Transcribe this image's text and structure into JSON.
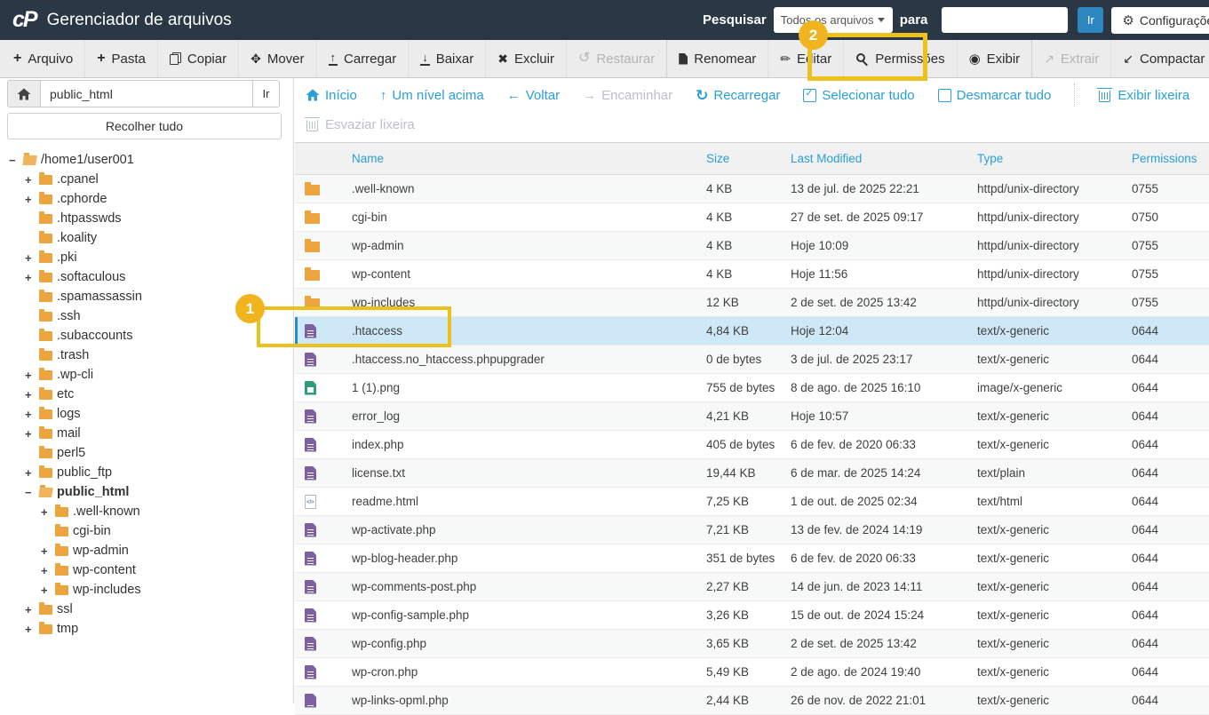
{
  "header": {
    "logo": "cP",
    "title": "Gerenciador de arquivos",
    "search_label": "Pesquisar",
    "search_scope": "Todos os arquivos",
    "para_label": "para",
    "search_value": "",
    "go_button": "Ir",
    "settings_button": "Configurações"
  },
  "toolbar": {
    "items": [
      {
        "label": "Arquivo",
        "icon": "plus-icon",
        "disabled": "false"
      },
      {
        "label": "Pasta",
        "icon": "plus-icon",
        "disabled": "false"
      },
      {
        "label": "Copiar",
        "icon": "copy-icon",
        "disabled": "false"
      },
      {
        "label": "Mover",
        "icon": "move-icon",
        "disabled": "false"
      },
      {
        "label": "Carregar",
        "icon": "upload-icon",
        "disabled": "false"
      },
      {
        "label": "Baixar",
        "icon": "download-icon",
        "disabled": "false"
      },
      {
        "label": "Excluir",
        "icon": "delete-icon",
        "disabled": "false"
      },
      {
        "label": "Restaurar",
        "icon": "restore-icon",
        "disabled": "true"
      },
      {
        "label": "Renomear",
        "icon": "page-icon",
        "disabled": "false"
      },
      {
        "label": "Editar",
        "icon": "pencil-icon",
        "disabled": "false"
      },
      {
        "label": "Permissões",
        "icon": "key-icon",
        "disabled": "false"
      },
      {
        "label": "Exibir",
        "icon": "eye-icon",
        "disabled": "false"
      },
      {
        "label": "Extrair",
        "icon": "extract-icon",
        "disabled": "true"
      },
      {
        "label": "Compactar",
        "icon": "compress-icon",
        "disabled": "false"
      }
    ]
  },
  "nav": {
    "row1": [
      {
        "label": "Início",
        "icon": "home-icon",
        "disabled": "false"
      },
      {
        "label": "Um nível acima",
        "icon": "arrow-up-icon",
        "disabled": "false"
      },
      {
        "label": "Voltar",
        "icon": "arrow-left-icon",
        "disabled": "false"
      },
      {
        "label": "Encaminhar",
        "icon": "arrow-right-icon",
        "disabled": "true"
      },
      {
        "label": "Recarregar",
        "icon": "refresh-icon",
        "disabled": "false"
      },
      {
        "label": "Selecionar tudo",
        "icon": "checkbox-checked-icon",
        "disabled": "false"
      },
      {
        "label": "Desmarcar tudo",
        "icon": "checkbox-empty-icon",
        "disabled": "false"
      },
      {
        "label": "Exibir lixeira",
        "icon": "trash-icon",
        "disabled": "false"
      }
    ],
    "row2": [
      {
        "label": "Esvaziar lixeira",
        "icon": "trash-icon",
        "disabled": "true"
      }
    ]
  },
  "sidebar": {
    "path_value": "public_html",
    "go_button": "Ir",
    "collapse_button": "Recolher tudo",
    "tree": [
      {
        "label": "/home1/user001",
        "toggle": "−",
        "icon": "folder-open",
        "level": 0,
        "bold": "false"
      },
      {
        "label": ".cpanel",
        "toggle": "+",
        "icon": "folder",
        "level": 1,
        "bold": "false"
      },
      {
        "label": ".cphorde",
        "toggle": "+",
        "icon": "folder",
        "level": 1,
        "bold": "false"
      },
      {
        "label": ".htpasswds",
        "toggle": "",
        "icon": "folder",
        "level": 1,
        "bold": "false"
      },
      {
        "label": ".koality",
        "toggle": "",
        "icon": "folder",
        "level": 1,
        "bold": "false"
      },
      {
        "label": ".pki",
        "toggle": "+",
        "icon": "folder",
        "level": 1,
        "bold": "false"
      },
      {
        "label": ".softaculous",
        "toggle": "+",
        "icon": "folder",
        "level": 1,
        "bold": "false"
      },
      {
        "label": ".spamassassin",
        "toggle": "",
        "icon": "folder",
        "level": 1,
        "bold": "false"
      },
      {
        "label": ".ssh",
        "toggle": "",
        "icon": "folder",
        "level": 1,
        "bold": "false"
      },
      {
        "label": ".subaccounts",
        "toggle": "",
        "icon": "folder",
        "level": 1,
        "bold": "false"
      },
      {
        "label": ".trash",
        "toggle": "",
        "icon": "folder",
        "level": 1,
        "bold": "false"
      },
      {
        "label": ".wp-cli",
        "toggle": "+",
        "icon": "folder",
        "level": 1,
        "bold": "false"
      },
      {
        "label": "etc",
        "toggle": "+",
        "icon": "folder",
        "level": 1,
        "bold": "false"
      },
      {
        "label": "logs",
        "toggle": "+",
        "icon": "folder",
        "level": 1,
        "bold": "false"
      },
      {
        "label": "mail",
        "toggle": "+",
        "icon": "folder",
        "level": 1,
        "bold": "false"
      },
      {
        "label": "perl5",
        "toggle": "",
        "icon": "folder",
        "level": 1,
        "bold": "false"
      },
      {
        "label": "public_ftp",
        "toggle": "+",
        "icon": "folder",
        "level": 1,
        "bold": "false"
      },
      {
        "label": "public_html",
        "toggle": "−",
        "icon": "folder-open",
        "level": 1,
        "bold": "true"
      },
      {
        "label": ".well-known",
        "toggle": "+",
        "icon": "folder",
        "level": 2,
        "bold": "false"
      },
      {
        "label": "cgi-bin",
        "toggle": "",
        "icon": "folder",
        "level": 2,
        "bold": "false"
      },
      {
        "label": "wp-admin",
        "toggle": "+",
        "icon": "folder",
        "level": 2,
        "bold": "false"
      },
      {
        "label": "wp-content",
        "toggle": "+",
        "icon": "folder",
        "level": 2,
        "bold": "false"
      },
      {
        "label": "wp-includes",
        "toggle": "+",
        "icon": "folder",
        "level": 2,
        "bold": "false"
      },
      {
        "label": "ssl",
        "toggle": "+",
        "icon": "folder",
        "level": 1,
        "bold": "false"
      },
      {
        "label": "tmp",
        "toggle": "+",
        "icon": "folder",
        "level": 1,
        "bold": "false"
      }
    ]
  },
  "files": {
    "columns": {
      "name": "Name",
      "size": "Size",
      "modified": "Last Modified",
      "type": "Type",
      "permissions": "Permissions"
    },
    "rows": [
      {
        "name": ".well-known",
        "size": "4 KB",
        "modified": "13 de jul. de 2025 22:21",
        "type": "httpd/unix-directory",
        "permissions": "0755",
        "icon": "folder",
        "selected": "false"
      },
      {
        "name": "cgi-bin",
        "size": "4 KB",
        "modified": "27 de set. de 2025 09:17",
        "type": "httpd/unix-directory",
        "permissions": "0750",
        "icon": "folder",
        "selected": "false"
      },
      {
        "name": "wp-admin",
        "size": "4 KB",
        "modified": "Hoje 10:09",
        "type": "httpd/unix-directory",
        "permissions": "0755",
        "icon": "folder",
        "selected": "false"
      },
      {
        "name": "wp-content",
        "size": "4 KB",
        "modified": "Hoje 11:56",
        "type": "httpd/unix-directory",
        "permissions": "0755",
        "icon": "folder",
        "selected": "false"
      },
      {
        "name": "wp-includes",
        "size": "12 KB",
        "modified": "2 de set. de 2025 13:42",
        "type": "httpd/unix-directory",
        "permissions": "0755",
        "icon": "folder",
        "selected": "false"
      },
      {
        "name": ".htaccess",
        "size": "4,84 KB",
        "modified": "Hoje 12:04",
        "type": "text/x-generic",
        "permissions": "0644",
        "icon": "file",
        "selected": "true"
      },
      {
        "name": ".htaccess.no_htaccess.phpupgrader",
        "size": "0 de bytes",
        "modified": "3 de jul. de 2025 23:17",
        "type": "text/x-generic",
        "permissions": "0644",
        "icon": "file",
        "selected": "false"
      },
      {
        "name": "1 (1).png",
        "size": "755 de bytes",
        "modified": "8 de ago. de 2025 16:10",
        "type": "image/x-generic",
        "permissions": "0644",
        "icon": "image",
        "selected": "false"
      },
      {
        "name": "error_log",
        "size": "4,21 KB",
        "modified": "Hoje 10:57",
        "type": "text/x-generic",
        "permissions": "0644",
        "icon": "file",
        "selected": "false"
      },
      {
        "name": "index.php",
        "size": "405 de bytes",
        "modified": "6 de fev. de 2020 06:33",
        "type": "text/x-generic",
        "permissions": "0644",
        "icon": "file",
        "selected": "false"
      },
      {
        "name": "license.txt",
        "size": "19,44 KB",
        "modified": "6 de mar. de 2025 14:24",
        "type": "text/plain",
        "permissions": "0644",
        "icon": "file",
        "selected": "false"
      },
      {
        "name": "readme.html",
        "size": "7,25 KB",
        "modified": "1 de out. de 2025 02:34",
        "type": "text/html",
        "permissions": "0644",
        "icon": "html",
        "selected": "false"
      },
      {
        "name": "wp-activate.php",
        "size": "7,21 KB",
        "modified": "13 de fev. de 2024 14:19",
        "type": "text/x-generic",
        "permissions": "0644",
        "icon": "file",
        "selected": "false"
      },
      {
        "name": "wp-blog-header.php",
        "size": "351 de bytes",
        "modified": "6 de fev. de 2020 06:33",
        "type": "text/x-generic",
        "permissions": "0644",
        "icon": "file",
        "selected": "false"
      },
      {
        "name": "wp-comments-post.php",
        "size": "2,27 KB",
        "modified": "14 de jun. de 2023 14:11",
        "type": "text/x-generic",
        "permissions": "0644",
        "icon": "file",
        "selected": "false"
      },
      {
        "name": "wp-config-sample.php",
        "size": "3,26 KB",
        "modified": "15 de out. de 2024 15:24",
        "type": "text/x-generic",
        "permissions": "0644",
        "icon": "file",
        "selected": "false"
      },
      {
        "name": "wp-config.php",
        "size": "3,65 KB",
        "modified": "2 de set. de 2025 13:42",
        "type": "text/x-generic",
        "permissions": "0644",
        "icon": "file",
        "selected": "false"
      },
      {
        "name": "wp-cron.php",
        "size": "5,49 KB",
        "modified": "2 de ago. de 2024 19:40",
        "type": "text/x-generic",
        "permissions": "0644",
        "icon": "file",
        "selected": "false"
      },
      {
        "name": "wp-links-opml.php",
        "size": "2,44 KB",
        "modified": "26 de nov. de 2022 21:01",
        "type": "text/x-generic",
        "permissions": "0644",
        "icon": "file",
        "selected": "false"
      }
    ]
  },
  "annotations": {
    "step1": "1",
    "step2": "2"
  },
  "colors": {
    "header_bg": "#2a3744",
    "link_blue": "#2a9fd8",
    "selected_row_bg": "#cfe8f7",
    "annotation_yellow": "#edc11d",
    "badge_gold": "#f0b41e",
    "folder_orange": "#eba43e",
    "file_purple": "#7d60a3",
    "image_green": "#2f9d77",
    "go_button_blue": "#2e86c1"
  }
}
